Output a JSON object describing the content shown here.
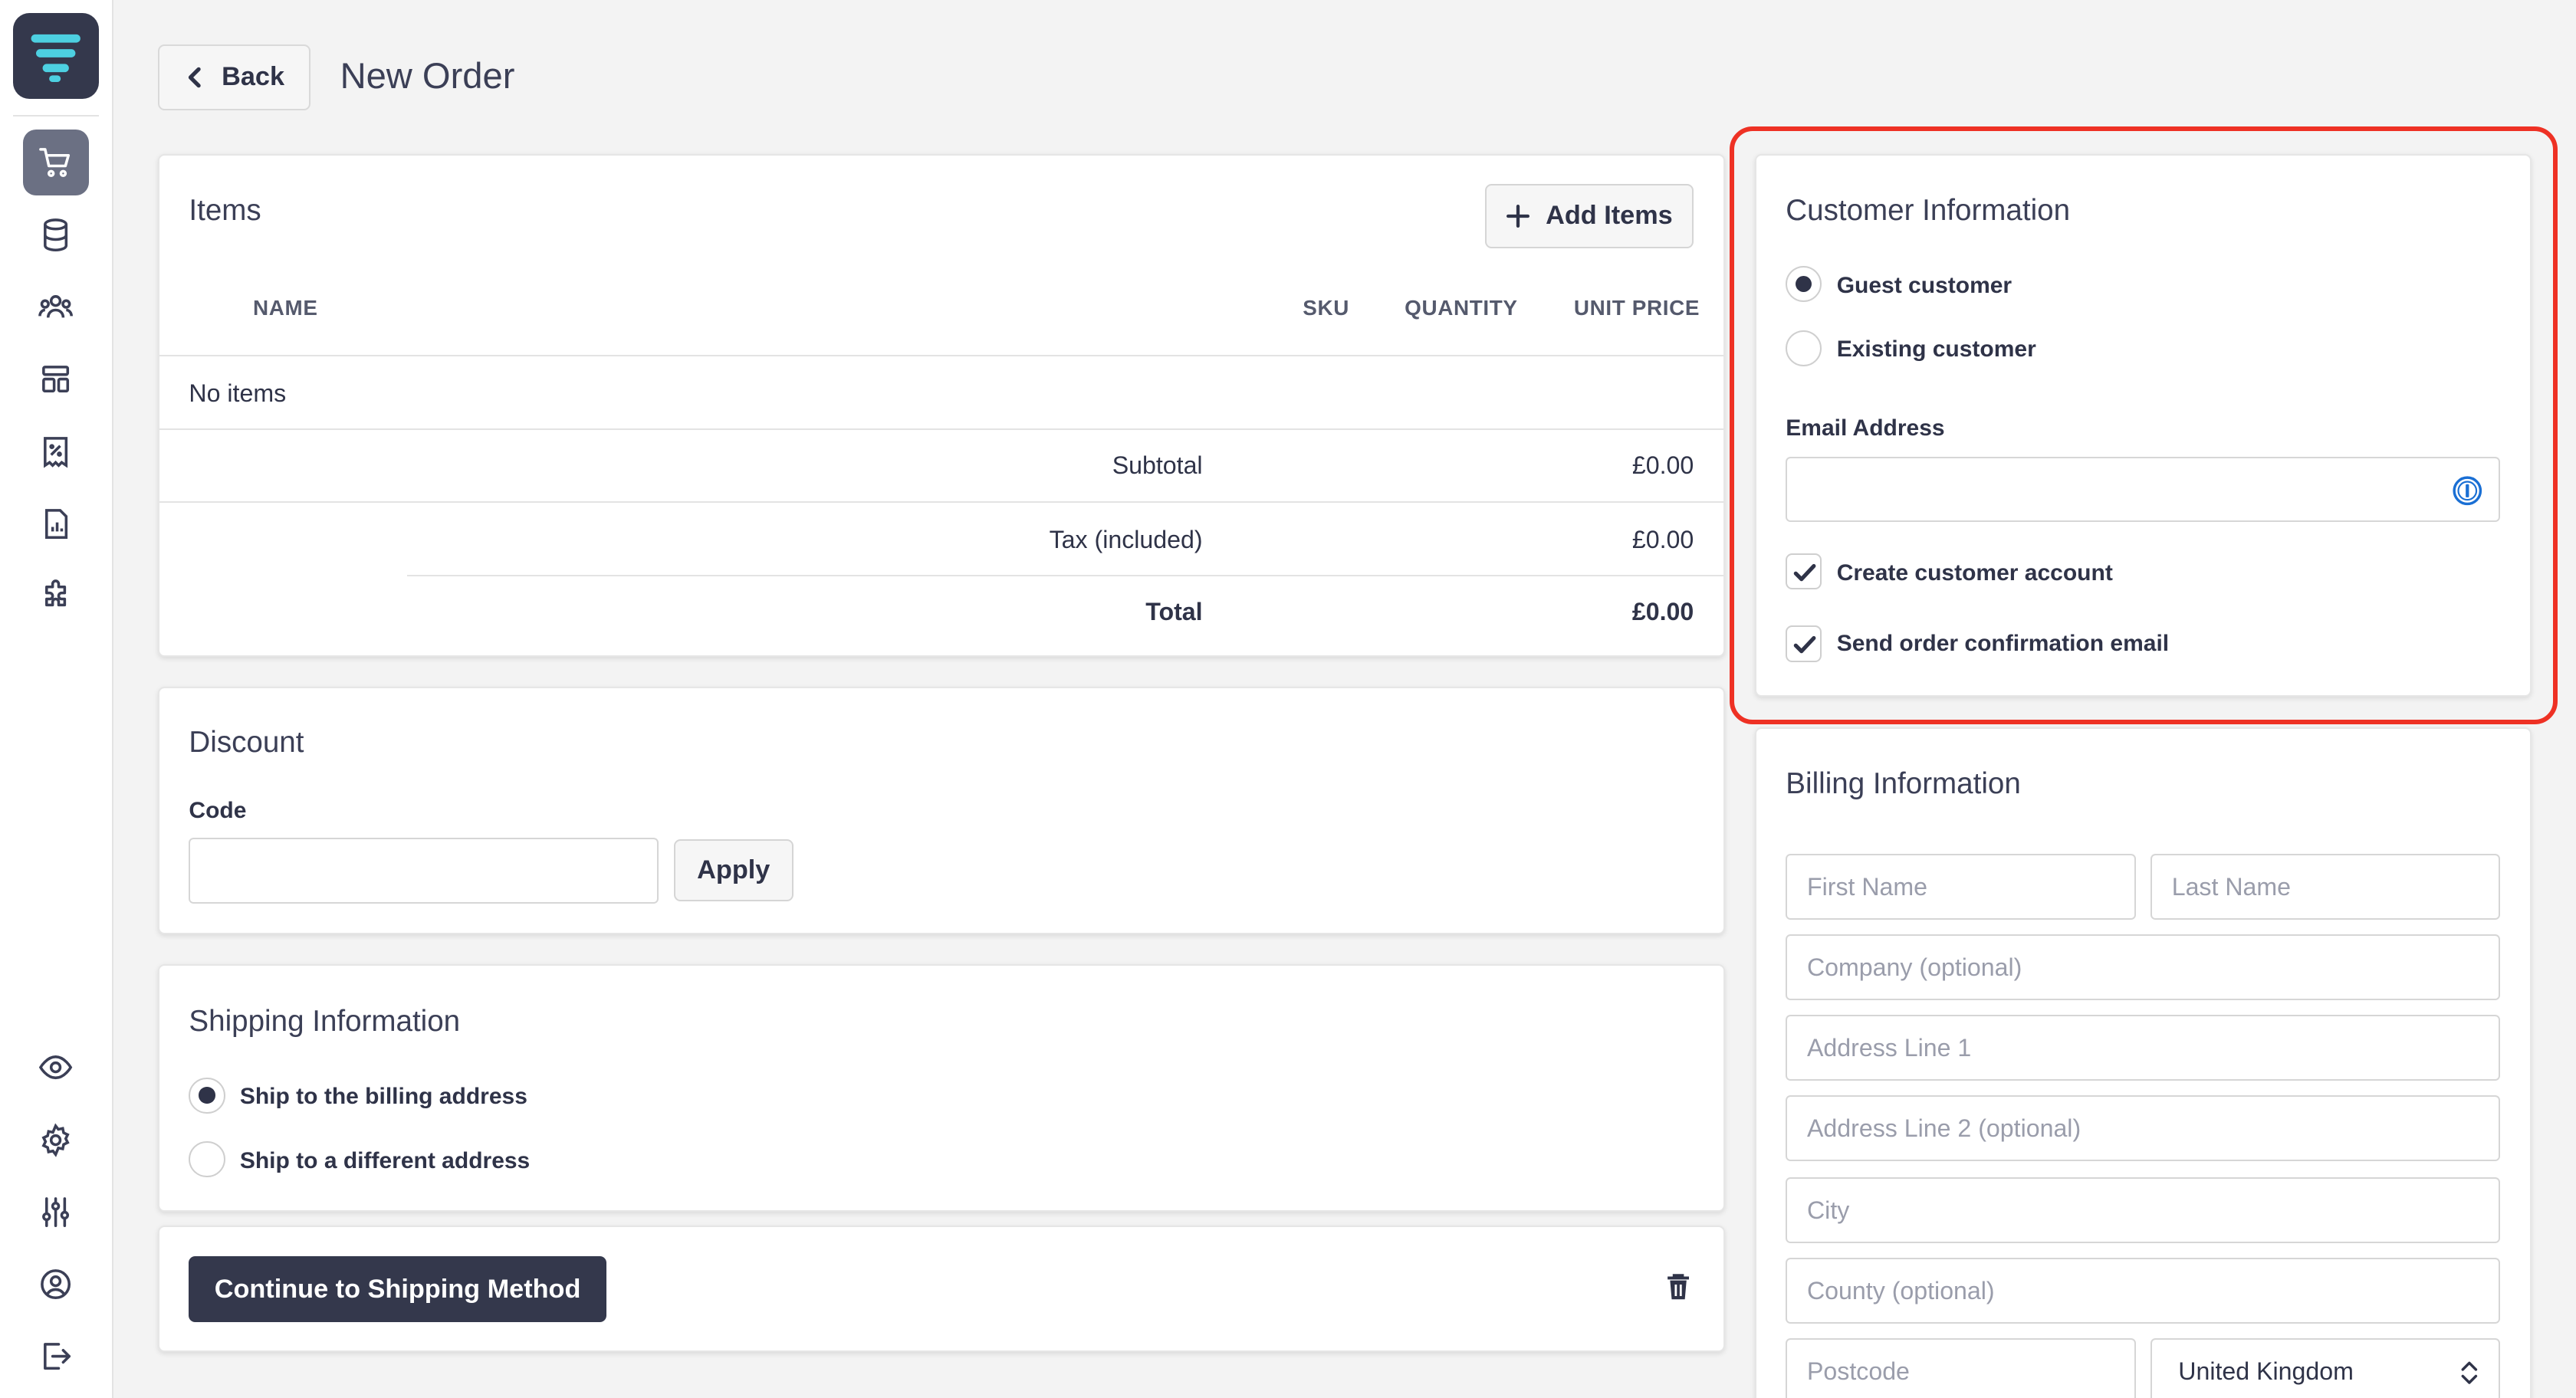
{
  "header": {
    "back_label": "Back",
    "title": "New Order"
  },
  "sidebar": {
    "items": [
      {
        "name": "orders",
        "icon": "cart-icon",
        "active": true
      },
      {
        "name": "database",
        "icon": "database-icon"
      },
      {
        "name": "customers",
        "icon": "users-icon"
      },
      {
        "name": "layout",
        "icon": "layout-icon"
      },
      {
        "name": "discounts",
        "icon": "discount-icon"
      },
      {
        "name": "reports",
        "icon": "report-icon"
      },
      {
        "name": "extensions",
        "icon": "puzzle-icon"
      },
      {
        "name": "preview",
        "icon": "eye-icon"
      },
      {
        "name": "settings",
        "icon": "gear-icon"
      },
      {
        "name": "preferences",
        "icon": "sliders-icon"
      },
      {
        "name": "account",
        "icon": "user-circle-icon"
      },
      {
        "name": "logout",
        "icon": "logout-icon"
      }
    ]
  },
  "items_card": {
    "title": "Items",
    "add_button": "Add Items",
    "columns": [
      "NAME",
      "SKU",
      "QUANTITY",
      "UNIT PRICE"
    ],
    "empty_text": "No items",
    "subtotal_label": "Subtotal",
    "subtotal_value": "£0.00",
    "tax_label": "Tax (included)",
    "tax_value": "£0.00",
    "total_label": "Total",
    "total_value": "£0.00"
  },
  "discount": {
    "title": "Discount",
    "code_label": "Code",
    "code_value": "",
    "apply_label": "Apply"
  },
  "shipping": {
    "title": "Shipping Information",
    "options": [
      "Ship to the billing address",
      "Ship to a different address"
    ],
    "selected": 0
  },
  "actions": {
    "continue_label": "Continue to Shipping Method"
  },
  "customer": {
    "title": "Customer Information",
    "options": [
      "Guest customer",
      "Existing customer"
    ],
    "selected": 0,
    "email_label": "Email Address",
    "email_value": "",
    "create_account_label": "Create customer account",
    "create_account_checked": true,
    "send_email_label": "Send order confirmation email",
    "send_email_checked": true
  },
  "billing": {
    "title": "Billing Information",
    "placeholders": {
      "first_name": "First Name",
      "last_name": "Last Name",
      "company": "Company (optional)",
      "address1": "Address Line 1",
      "address2": "Address Line 2 (optional)",
      "city": "City",
      "county": "County (optional)",
      "postcode": "Postcode"
    },
    "country": "United Kingdom"
  },
  "colors": {
    "primary": "#34384c",
    "highlight": "#ee3124",
    "accent": "#4dd0e1"
  }
}
